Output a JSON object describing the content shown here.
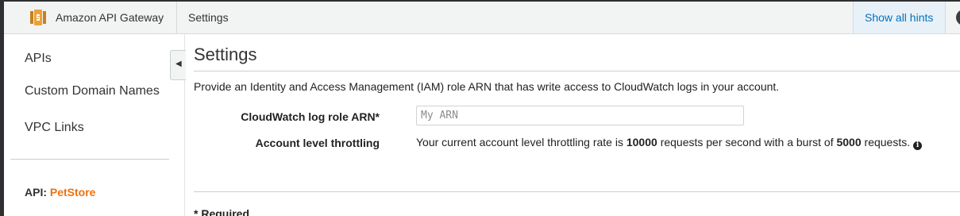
{
  "header": {
    "app_title": "Amazon API Gateway",
    "page_crumb": "Settings",
    "hints_label": "Show all hints",
    "logo_icon": "api-gateway-logo",
    "brand_color": "#ec7211"
  },
  "sidebar": {
    "items": [
      {
        "label": "APIs"
      },
      {
        "label": "Custom Domain Names"
      },
      {
        "label": "VPC Links"
      }
    ],
    "api_prefix": "API:",
    "api_name": "PetStore",
    "collapse_icon": "chevron-left-icon"
  },
  "main": {
    "title": "Settings",
    "intro": "Provide an Identity and Access Management (IAM) role ARN that has write access to CloudWatch logs in your account.",
    "arn_label": "CloudWatch log role ARN*",
    "arn_placeholder": "My ARN",
    "arn_value": "",
    "throttle_label": "Account level throttling",
    "throttle_part1": "Your current account level throttling rate is",
    "throttle_rate": "10000",
    "throttle_part2": "requests per second with a burst of",
    "throttle_burst": "5000",
    "throttle_part3": "requests.",
    "info_icon": "info-icon",
    "required_note": "* Required"
  }
}
